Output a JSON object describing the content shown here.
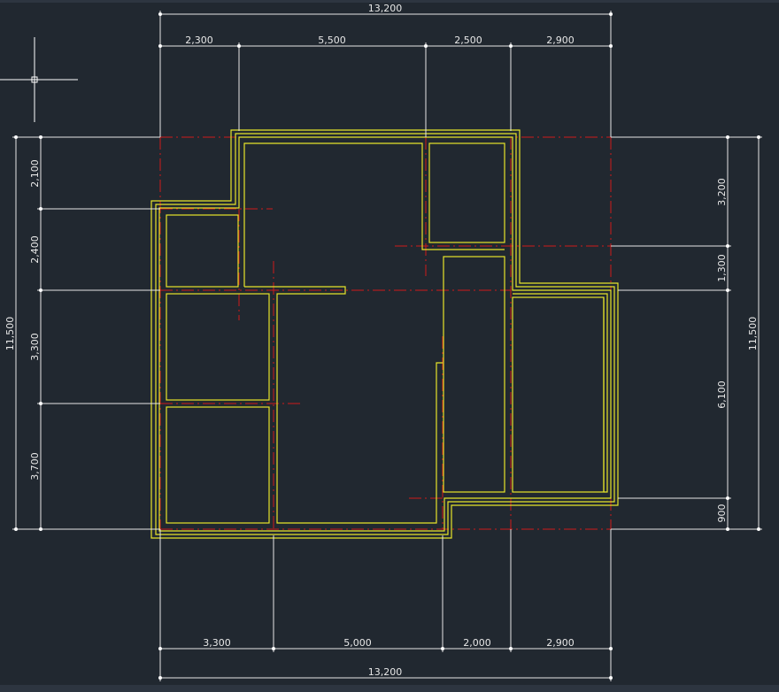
{
  "drawing": {
    "dimensions": {
      "top_total": "13,200",
      "top_segments": [
        "2,300",
        "5,500",
        "2,500",
        "2,900"
      ],
      "bottom_total": "13,200",
      "bottom_segments": [
        "3,300",
        "5,000",
        "2,000",
        "2,900"
      ],
      "left_total": "11,500",
      "left_segments": [
        "2,100",
        "2,400",
        "3,300",
        "3,700"
      ],
      "right_total": "11,500",
      "right_segments": [
        "3,200",
        "1,300",
        "6,100",
        "900"
      ]
    },
    "colors": {
      "background": "#212830",
      "wall": "#e7e42a",
      "axis": "#d01a1a",
      "dimension": "#e6e6e6"
    },
    "cursor_icon": "crosshair-icon"
  }
}
